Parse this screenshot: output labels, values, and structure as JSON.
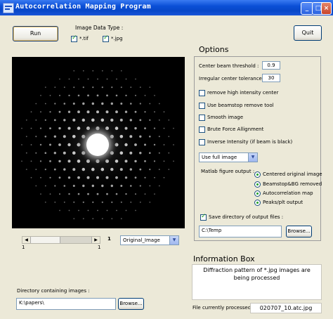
{
  "window": {
    "title": "Autocorrelation Mapping Program"
  },
  "toolbar": {
    "run_label": "Run",
    "quit_label": "Quit"
  },
  "image_type": {
    "label": "Image Data Type :",
    "tif": {
      "label": "*.tif",
      "checked": true
    },
    "jpg": {
      "label": "*.jpg",
      "checked": true
    }
  },
  "slider": {
    "value_label": "1",
    "min_label": "1",
    "max_label": "1",
    "view_select": "Original_Image"
  },
  "directory": {
    "label": "Directory containing images :",
    "value": "K:\\papers\\",
    "browse_label": "Browse..."
  },
  "options": {
    "title": "Options",
    "center_threshold_label": "Center beam threshold :",
    "center_threshold_value": "0.9",
    "irregular_label": "Irregular center tolerance :",
    "irregular_value": "30",
    "checkboxes": [
      {
        "label": "remove high intensity center",
        "checked": false
      },
      {
        "label": "Use beamstop remove tool",
        "checked": false
      },
      {
        "label": "Smooth image",
        "checked": false
      },
      {
        "label": "Brute Force Allignment",
        "checked": false
      },
      {
        "label": "Inverse Intensity (if beam is black)",
        "checked": false
      }
    ],
    "image_select": "Use full image",
    "matlab_label": "Matlab figure output :",
    "outputs": [
      "Centered original image",
      "Beamstop&BG removed",
      "Autocorrelation map",
      "Peaks/plt output"
    ],
    "save_dir_label": "Save directory of output files :",
    "save_dir_checked": true,
    "save_dir_value": "C:\\Temp",
    "browse_label": "Browse..."
  },
  "info": {
    "title": "Information Box",
    "message": "Diffraction pattern of *.jpg images are being processed",
    "current_label": "File currently processed :",
    "current_file": "020707_10.atc.jpg"
  },
  "colors": {
    "titlebar": "#0a4fd6",
    "check": "#21a121",
    "face": "#ece9d8"
  },
  "icons": {
    "window": "app-icon",
    "minimize": "minimize-icon",
    "maximize": "maximize-icon",
    "close": "close-icon",
    "dropdown": "chevron-down-icon"
  }
}
